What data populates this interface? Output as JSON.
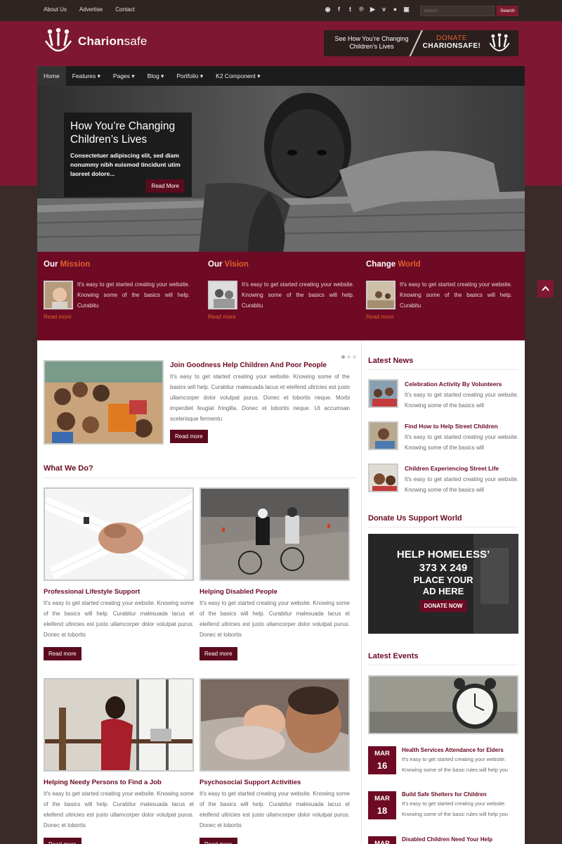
{
  "topbar": {
    "links": [
      "About Us",
      "Advertise",
      "Contact"
    ],
    "social_icons": [
      "rss-icon",
      "facebook-icon",
      "twitter-icon",
      "pinterest-icon",
      "youtube-icon",
      "vimeo-icon",
      "flickr-icon",
      "instagram-icon"
    ],
    "search_placeholder": "Search ...",
    "search_label": "Search"
  },
  "header": {
    "logo_bold": "Charion",
    "logo_light": "safe",
    "banner_left": "See How You’re Changing Children’s Lives",
    "banner_donate": "DONATE",
    "banner_brand": "CHARIONSAFE!"
  },
  "nav": {
    "items": [
      "Home",
      "Features",
      "Pages",
      "Blog",
      "Portfolio",
      "K2 Component"
    ]
  },
  "hero": {
    "title": "How You’re Changing Children’s Lives",
    "text": "Consectetuer adipiscing elit, sed diam nonummy nibh euismod tincidunt utim laoreet dolore...",
    "button": "Read More"
  },
  "features": [
    {
      "title_a": "Our ",
      "title_b": "Mission",
      "text": "It's easy to get started creating your website. Knowing some of the basics will help. Curabitu",
      "more": "Read more"
    },
    {
      "title_a": "Our ",
      "title_b": "Vision",
      "text": "It's easy to get started creating your website. Knowing some of the basics will help. Curabitu",
      "more": "Read more"
    },
    {
      "title_a": "Change ",
      "title_b": "World",
      "text": "It's easy to get started creating your website. Knowing some of the basics will help. Curabitu",
      "more": "Read more"
    }
  ],
  "featured": {
    "title": "Join Goodness Help Children And Poor People",
    "text": "It's easy to get started creating your website. Knowing some of the basics will help. Curabitur malesuada lacus et eleifend ultricies est justo ullamcorper dolor volutpat purus. Donec et lobortis neque. Morbi imperdiet feugiat fringilla. Donec et lobortis neque. Ut accumsan scelerisque fermentu",
    "button": "Read more"
  },
  "what_we_do": {
    "heading": "What We Do?",
    "cards": [
      {
        "title": "Professional Lifestyle Support",
        "text": "It's easy to get started creating your website. Knowing some of the basics will help. Curabitur malesuada lacus et eleifend ultricies est justo ullamcorper dolor volutpat purus. Donec et lobortis",
        "button": "Read more"
      },
      {
        "title": "Helping Disabled People",
        "text": "It's easy to get started creating your website. Knowing some of the basics will help. Curabitur malesuada lacus et eleifend ultricies est justo ullamcorper dolor volutpat purus. Donec et lobortis",
        "button": "Read more"
      },
      {
        "title": "Helping Needy Persons to Find a Job",
        "text": "It's easy to get started creating your website. Knowing some of the basics will help. Curabitur malesuada lacus et eleifend ultricies est justo ullamcorper dolor volutpat purus. Donec et lobortis",
        "button": "Read more"
      },
      {
        "title": "Psychosocial Support Activities",
        "text": "It's easy to get started creating your website. Knowing some of the basics will help. Curabitur malesuada lacus et eleifend ultricies est justo ullamcorper dolor volutpat purus. Donec et lobortis",
        "button": "Read more"
      }
    ]
  },
  "sidebar": {
    "latest_news_heading": "Latest News",
    "news": [
      {
        "title": "Celebration Activity By Volunteers",
        "text": "It's easy to get started creating your website. Knowing some of the basics will"
      },
      {
        "title": "Find How to Help Street Children",
        "text": "It's easy to get started creating your website. Knowing some of the basics will"
      },
      {
        "title": "Children Experiencing Street Life",
        "text": "It's easy to get started creating your website. Knowing some of the basics will"
      }
    ],
    "donate_heading": "Donate Us Support World",
    "ad": {
      "line1": "HELP HOMELESS’",
      "line2": "373 X 249",
      "line3": "PLACE YOUR",
      "line4": "AD HERE",
      "button": "DONATE NOW"
    },
    "events_heading": "Latest Events",
    "events": [
      {
        "month": "MAR",
        "day": "16",
        "title": "Health Services Attendance for Elders",
        "text": "It's easy to get started creating your website. Knowing some of the basic rules will help you"
      },
      {
        "month": "MAR",
        "day": "18",
        "title": "Build Safe Shelters for Children",
        "text": "It's easy to get started creating your website. Knowing some of the basic rules will help you"
      },
      {
        "month": "MAR",
        "day": "",
        "title": "Disabled Children Need Your Help",
        "text": ""
      }
    ]
  },
  "colors": {
    "brand": "#7e1832",
    "dark": "#2e2422",
    "accent": "#e0602a"
  }
}
